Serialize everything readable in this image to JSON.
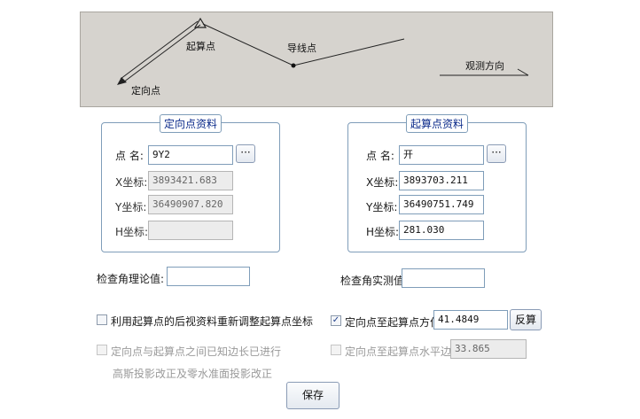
{
  "diagram": {
    "label_start": "起算点",
    "label_traverse": "导线点",
    "label_direction": "观测方向",
    "label_orient": "定向点"
  },
  "orient_group": {
    "title": "定向点资料",
    "name_label": "点 名:",
    "name_value": "9Y2",
    "browse_label": "···",
    "x_label": "X坐标:",
    "x_value": "3893421.683",
    "y_label": "Y坐标:",
    "y_value": "36490907.820",
    "h_label": "H坐标:",
    "h_value": ""
  },
  "start_group": {
    "title": "起算点资料",
    "name_label": "点 名:",
    "name_value": "开",
    "browse_label": "···",
    "x_label": "X坐标:",
    "x_value": "3893703.211",
    "y_label": "Y坐标:",
    "y_value": "36490751.749",
    "h_label": "H坐标:",
    "h_value": "281.030"
  },
  "check_theory": {
    "label": "检查角理论值:",
    "value": ""
  },
  "check_measured": {
    "label": "检查角实测值:",
    "value": ""
  },
  "options": {
    "readjust": {
      "label": "利用起算点的后视资料重新调整起算点坐标",
      "checked": false
    },
    "gauss": {
      "line1": "定向点与起算点之间已知边长已进行",
      "line2": "高斯投影改正及零水准面投影改正",
      "checked": false
    },
    "azimuth": {
      "label": "定向点至起算点方位:",
      "value": "41.4849",
      "checked": true,
      "button": "反算"
    },
    "distance": {
      "label": "定向点至起算点水平边长:",
      "value": "33.865",
      "checked": false
    }
  },
  "save_label": "保存"
}
